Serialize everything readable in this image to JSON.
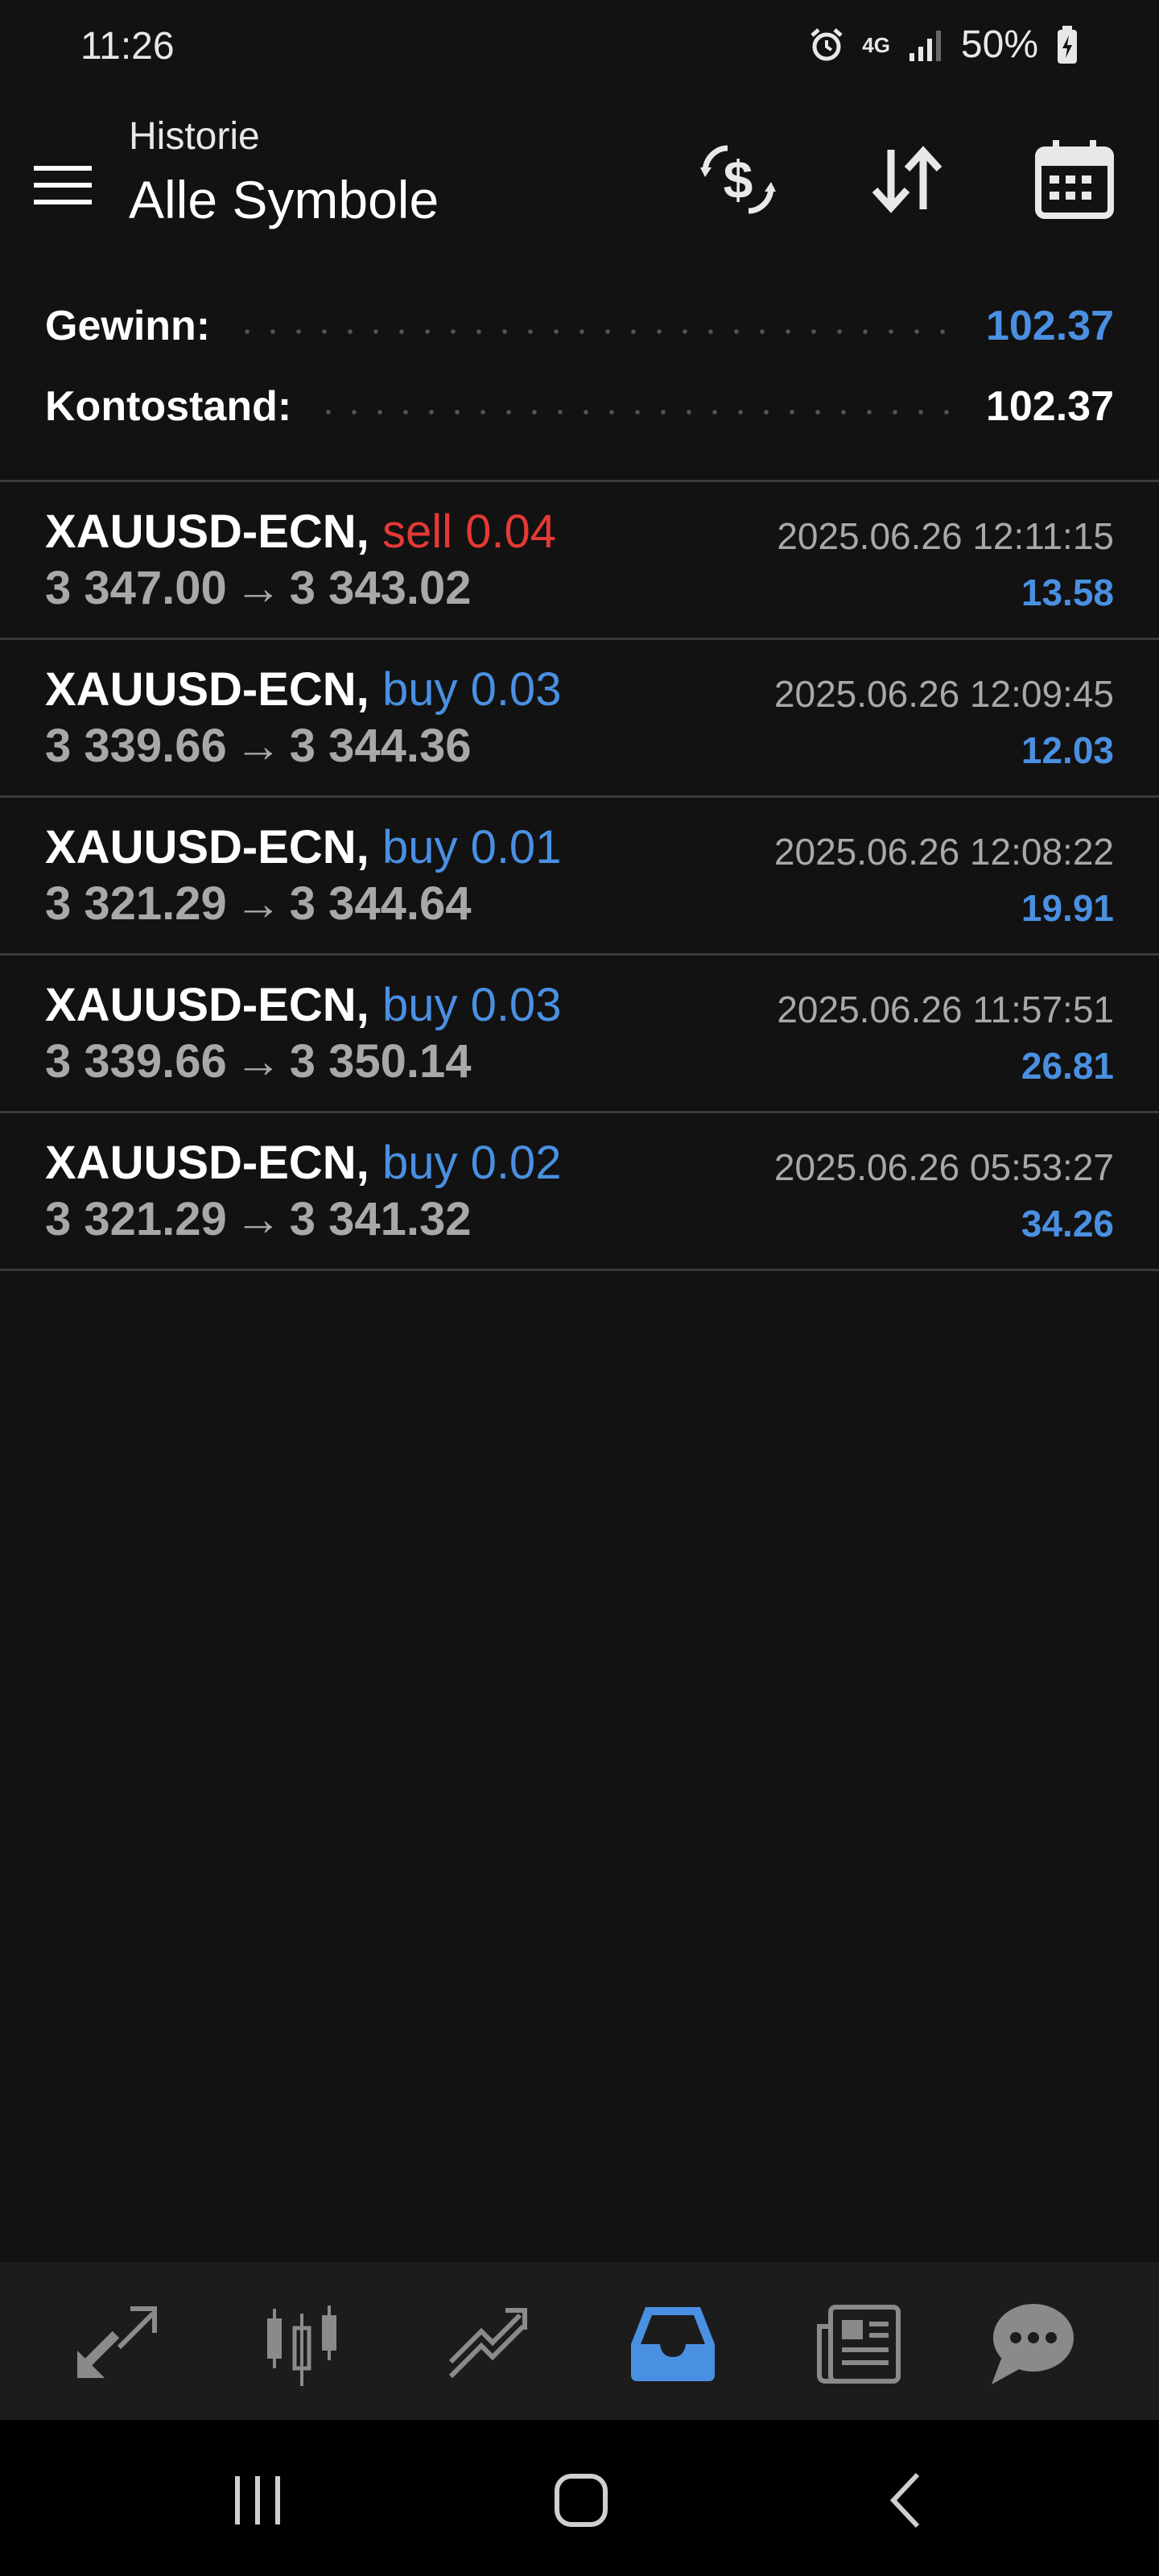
{
  "status_bar": {
    "time": "11:26",
    "network": "4G",
    "battery": "50%"
  },
  "header": {
    "subtitle": "Historie",
    "title": "Alle Symbole"
  },
  "summary": {
    "profit_label": "Gewinn:",
    "profit_value": "102.37",
    "balance_label": "Kontostand:",
    "balance_value": "102.37"
  },
  "trades": [
    {
      "symbol": "XAUUSD-ECN,",
      "side": "sell 0.04",
      "open": "3 347.00",
      "close": "3 343.02",
      "time": "2025.06.26 12:11:15",
      "profit": "13.58"
    },
    {
      "symbol": "XAUUSD-ECN,",
      "side": "buy 0.03",
      "open": "3 339.66",
      "close": "3 344.36",
      "time": "2025.06.26 12:09:45",
      "profit": "12.03"
    },
    {
      "symbol": "XAUUSD-ECN,",
      "side": "buy 0.01",
      "open": "3 321.29",
      "close": "3 344.64",
      "time": "2025.06.26 12:08:22",
      "profit": "19.91"
    },
    {
      "symbol": "XAUUSD-ECN,",
      "side": "buy 0.03",
      "open": "3 339.66",
      "close": "3 350.14",
      "time": "2025.06.26 11:57:51",
      "profit": "26.81"
    },
    {
      "symbol": "XAUUSD-ECN,",
      "side": "buy 0.02",
      "open": "3 321.29",
      "close": "3 341.32",
      "time": "2025.06.26 05:53:27",
      "profit": "34.26"
    }
  ],
  "arrow": "→",
  "icons": {
    "header": [
      "menu-icon",
      "currency-exchange-icon",
      "sort-icon",
      "calendar-icon"
    ],
    "bottom_nav": [
      "quotes-icon",
      "chart-icon",
      "trade-icon",
      "history-icon",
      "news-icon",
      "chat-icon"
    ],
    "system_nav": [
      "recents-icon",
      "home-icon",
      "back-icon"
    ]
  },
  "colors": {
    "accent": "#4a90e2",
    "sell": "#e53935",
    "background": "#121212",
    "active_tab": "history-icon"
  }
}
